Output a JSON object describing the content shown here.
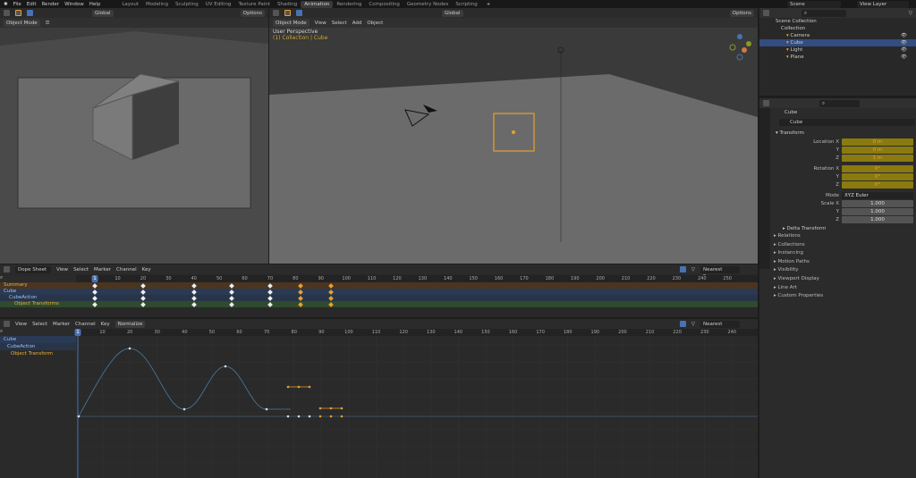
{
  "menu": {
    "items": [
      "File",
      "Edit",
      "Render",
      "Window",
      "Help"
    ],
    "workspaces": [
      "Layout",
      "Modeling",
      "Sculpting",
      "UV Editing",
      "Texture Paint",
      "Shading",
      "Animation",
      "Rendering",
      "Compositing",
      "Geometry Nodes",
      "Scripting"
    ],
    "active_workspace": "Animation",
    "scene": "Scene",
    "view_layer": "View Layer"
  },
  "left_view": {
    "orientation": "Global",
    "options": "Options",
    "mode": "Object Mode"
  },
  "main_view": {
    "orientation": "Global",
    "options": "Options",
    "mode": "Object Mode",
    "menus": [
      "View",
      "Select",
      "Add",
      "Object"
    ],
    "overlay_title": "User Perspective",
    "overlay_collection": "(1) Collection | Cube"
  },
  "outliner": {
    "root": "Scene Collection",
    "collection": "Collection",
    "items": [
      "Camera",
      "Cube",
      "Light",
      "Plane"
    ],
    "selected": "Cube"
  },
  "properties": {
    "object_name": "Cube",
    "data_name": "Cube",
    "section": "Transform",
    "location": {
      "label": "Location X",
      "x": "0 m",
      "y": "0 m",
      "z": "1 m"
    },
    "rotation": {
      "label": "Rotation X",
      "x": "0°",
      "y": "0°",
      "z": "0°"
    },
    "mode_label": "Mode",
    "mode": "XYZ Euler",
    "scale": {
      "label": "Scale X",
      "x": "1.000",
      "y": "1.000",
      "z": "1.000"
    },
    "axis_y": "Y",
    "axis_z": "Z",
    "delta": "Delta Transform",
    "panels": [
      "Relations",
      "Collections",
      "Instancing",
      "Motion Paths",
      "Visibility",
      "Viewport Display",
      "Line Art",
      "Custom Properties"
    ]
  },
  "dopesheet": {
    "editor": "Dope Sheet",
    "menus": [
      "View",
      "Select",
      "Marker",
      "Channel",
      "Key"
    ],
    "snap": "Nearest Frame",
    "current_frame": "1",
    "ticks": [
      "10",
      "20",
      "30",
      "40",
      "50",
      "60",
      "70",
      "80",
      "90",
      "100",
      "110",
      "120",
      "130",
      "140",
      "150",
      "160",
      "170",
      "180",
      "190",
      "200",
      "210",
      "220",
      "230",
      "240",
      "250"
    ],
    "channels": [
      "Summary",
      "Cube",
      "CubeAction",
      "Object Transforms"
    ],
    "keyframes": [
      1,
      20,
      40,
      55,
      70,
      82,
      94
    ],
    "selected_keyframes": [
      82,
      94
    ]
  },
  "graph": {
    "menus": [
      "View",
      "Select",
      "Marker",
      "Channel",
      "Key"
    ],
    "normalize": "Normalize",
    "snap": "Nearest Frame",
    "current_frame": "1",
    "ticks": [
      "10",
      "20",
      "30",
      "40",
      "50",
      "60",
      "70",
      "80",
      "90",
      "100",
      "110",
      "120",
      "130",
      "140",
      "150",
      "160",
      "170",
      "180",
      "190",
      "200",
      "210",
      "220",
      "230",
      "240"
    ],
    "channels": [
      "Cube",
      "CubeAction",
      "Object Transform"
    ]
  }
}
